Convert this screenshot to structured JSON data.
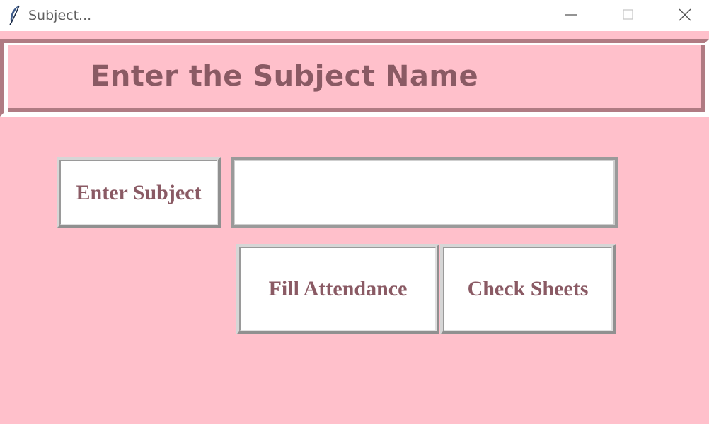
{
  "window": {
    "title": "Subject..."
  },
  "header": {
    "title": "Enter the Subject Name"
  },
  "form": {
    "subject_label": "Enter Subject",
    "subject_value": "",
    "fill_attendance_label": "Fill Attendance",
    "check_sheets_label": "Check Sheets"
  },
  "icons": {
    "app": "feather-icon",
    "minimize": "minimize-icon",
    "maximize": "maximize-icon",
    "close": "close-icon"
  },
  "colors": {
    "background": "#ffc0cb",
    "text": "#8a5a64",
    "frame": "#b07b83",
    "button_face": "#ffffff"
  }
}
